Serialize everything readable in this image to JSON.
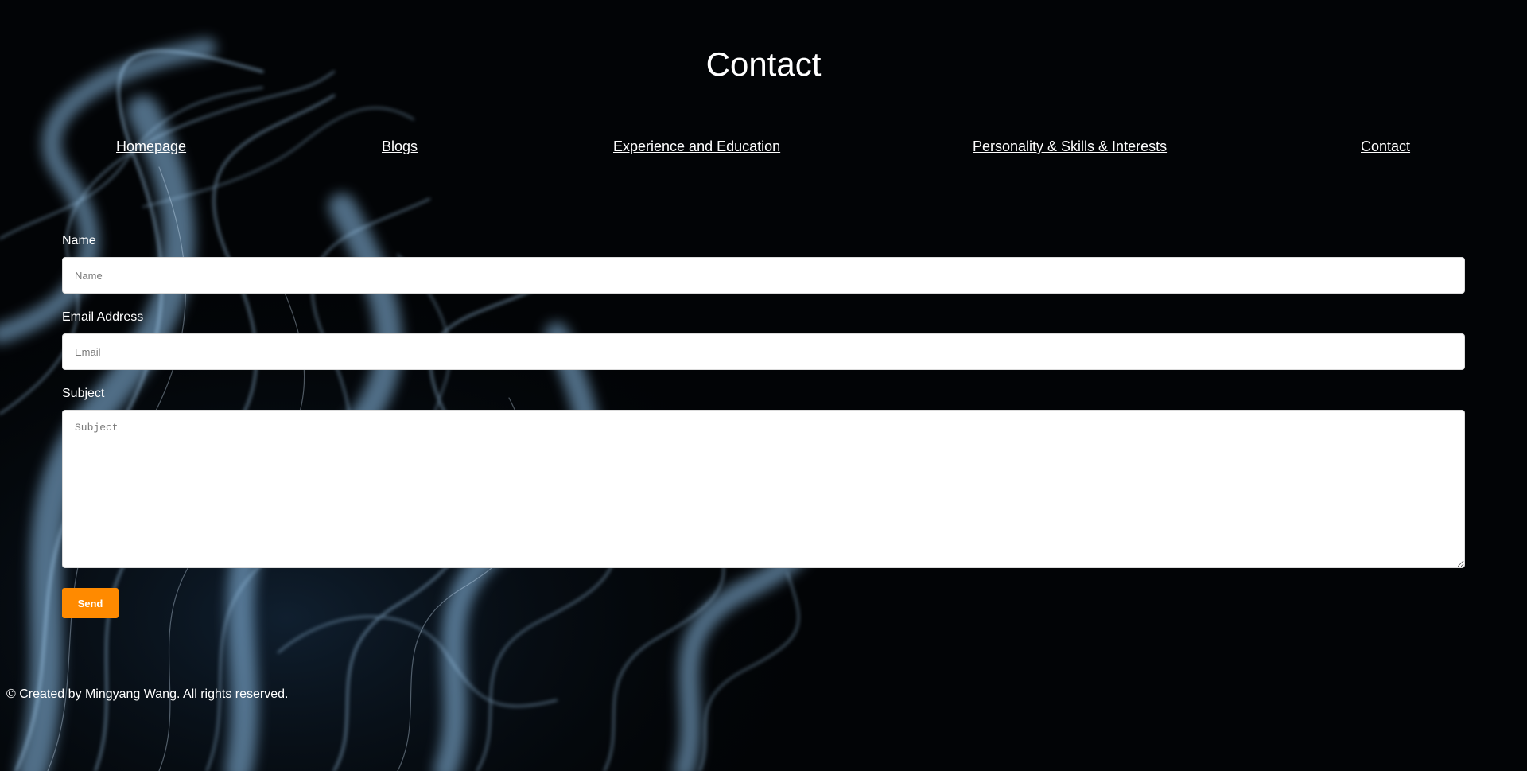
{
  "page": {
    "title": "Contact"
  },
  "nav": {
    "items": [
      {
        "label": "Homepage"
      },
      {
        "label": "Blogs"
      },
      {
        "label": "Experience and Education"
      },
      {
        "label": "Personality & Skills & Interests"
      },
      {
        "label": "Contact"
      }
    ]
  },
  "form": {
    "name_label": "Name",
    "name_placeholder": "Name",
    "name_value": "",
    "email_label": "Email Address",
    "email_placeholder": "Email",
    "email_value": "",
    "subject_label": "Subject",
    "subject_placeholder": "Subject",
    "subject_value": "",
    "send_label": "Send"
  },
  "footer": {
    "text": "© Created by Mingyang Wang. All rights reserved."
  },
  "colors": {
    "background": "#020406",
    "accent": "#ff8a00",
    "smoke": "#7fb3e0"
  }
}
